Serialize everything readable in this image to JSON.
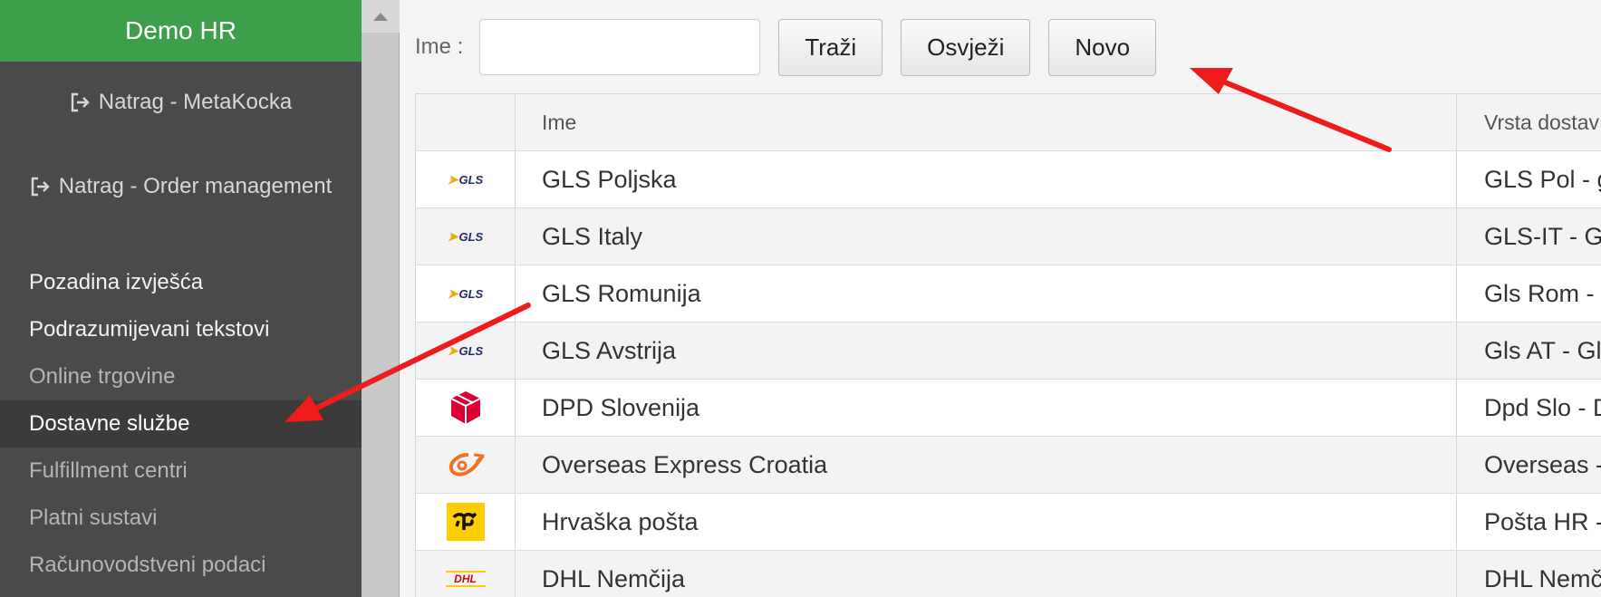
{
  "sidebar": {
    "brand": "Demo HR",
    "back_links": [
      {
        "label": "Natrag - MetaKocka"
      },
      {
        "label": "Natrag - Order management"
      }
    ],
    "items": [
      {
        "label": "Pozadina izvješća"
      },
      {
        "label": "Podrazumijevani tekstovi"
      },
      {
        "label": "Online trgovine"
      },
      {
        "label": "Dostavne službe"
      },
      {
        "label": "Fulfillment centri"
      },
      {
        "label": "Platni sustavi"
      },
      {
        "label": "Računovodstveni podaci"
      }
    ]
  },
  "toolbar": {
    "name_label": "Ime :",
    "name_value": "",
    "search_label": "Traži",
    "refresh_label": "Osvježi",
    "new_label": "Novo"
  },
  "grid": {
    "columns": [
      "Ime",
      "Vrsta dostav"
    ],
    "rows": [
      {
        "logo": "gls-logo",
        "name": "GLS Poljska",
        "type": "GLS Pol - g"
      },
      {
        "logo": "gls-logo",
        "name": "GLS Italy",
        "type": "GLS-IT - GL"
      },
      {
        "logo": "gls-logo",
        "name": "GLS Romunija",
        "type": "Gls Rom - G"
      },
      {
        "logo": "gls-logo",
        "name": "GLS Avstrija",
        "type": "Gls AT - Gls"
      },
      {
        "logo": "dpd-logo",
        "name": "DPD Slovenija",
        "type": "Dpd Slo - D"
      },
      {
        "logo": "overseas-logo",
        "name": "Overseas Express Croatia",
        "type": "Overseas -"
      },
      {
        "logo": "hrvatska-posta-logo",
        "name": "Hrvaška pošta",
        "type": "Pošta HR -"
      },
      {
        "logo": "dhl-logo",
        "name": "DHL Nemčija",
        "type": "DHL Nemč"
      }
    ]
  },
  "logo_text": {
    "gls": "GLS",
    "dhl": "DHL"
  },
  "colors": {
    "brand_green": "#3d9f4b",
    "sidebar": "#4a4a4a",
    "annotation_arrow": "#ee1c1c"
  }
}
